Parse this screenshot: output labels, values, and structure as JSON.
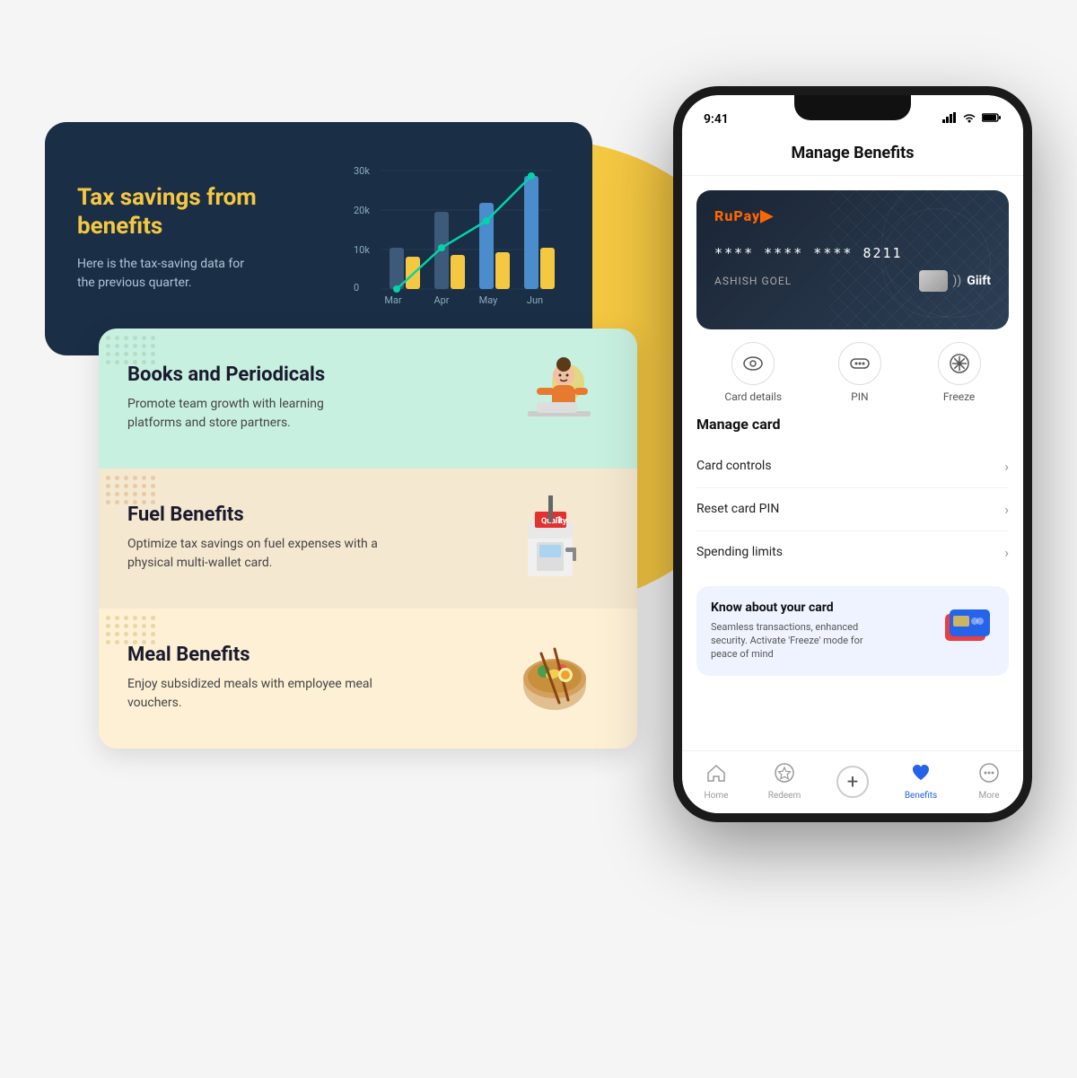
{
  "colors": {
    "accent_yellow": "#f5c842",
    "dark_navy": "#1a2e45",
    "teal_bg": "#c8f0e0",
    "peach_bg": "#f5e8d0",
    "cream_bg": "#fdf0d5",
    "blue_accent": "#2563eb"
  },
  "tax_card": {
    "title": "Tax savings from benefits",
    "description": "Here is the tax-saving  data for the previous quarter.",
    "chart": {
      "y_labels": [
        "30k",
        "20k",
        "10k",
        "0"
      ],
      "x_labels": [
        "Mar",
        "Apr",
        "May",
        "Jun"
      ]
    }
  },
  "benefits": [
    {
      "title": "Books and Periodicals",
      "description": "Promote team growth with learning platforms and store partners.",
      "emoji": "👩‍💻"
    },
    {
      "title": "Fuel Benefits",
      "description": "Optimize tax savings on fuel expenses with a physical multi-wallet card.",
      "emoji": "⛽"
    },
    {
      "title": "Meal Benefits",
      "description": "Enjoy subsidized meals with employee meal vouchers.",
      "emoji": "🍜"
    }
  ],
  "phone": {
    "status_time": "9:41",
    "header_title": "Manage Benefits",
    "card": {
      "brand": "RuPay",
      "number": "**** **** **** 8211",
      "holder": "ASHISH GOEL",
      "sub_brand": "Giift"
    },
    "quick_actions": [
      {
        "label": "Card details",
        "icon": "👁"
      },
      {
        "label": "PIN",
        "icon": "···"
      },
      {
        "label": "Freeze",
        "icon": "❄"
      }
    ],
    "manage_card_title": "Manage card",
    "menu_items": [
      {
        "label": "Card controls"
      },
      {
        "label": "Reset card PIN"
      },
      {
        "label": "Spending limits"
      }
    ],
    "know_card": {
      "title": "Know about your card",
      "description": "Seamless transactions, enhanced security. Activate 'Freeze' mode for peace of mind"
    },
    "nav": [
      {
        "label": "Home",
        "icon": "🏠",
        "active": false
      },
      {
        "label": "Redeem",
        "icon": "★",
        "active": false
      },
      {
        "label": "",
        "icon": "+",
        "active": false,
        "is_add": true
      },
      {
        "label": "Benefits",
        "icon": "♥",
        "active": true
      },
      {
        "label": "More",
        "icon": "···",
        "active": false
      }
    ]
  }
}
